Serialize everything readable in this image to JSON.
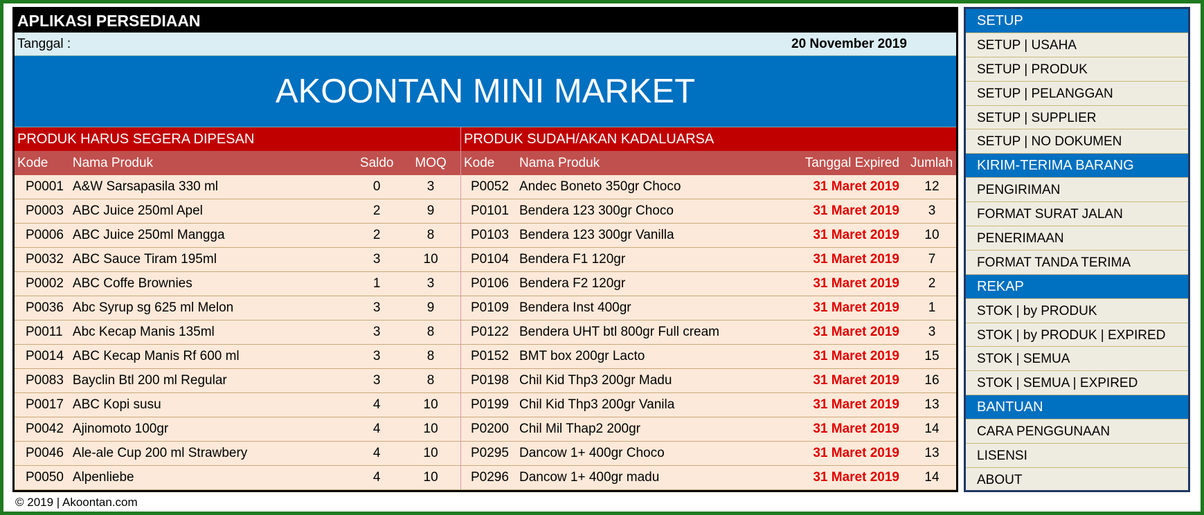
{
  "app": {
    "title": "APLIKASI PERSEDIAAN",
    "date_label": "Tanggal :",
    "date_value": "20 November 2019",
    "banner": "AKOONTAN MINI MARKET",
    "footer": "© 2019 | Akoontan.com"
  },
  "reorder": {
    "title": "PRODUK HARUS SEGERA DIPESAN",
    "headers": {
      "kode": "Kode",
      "nama": "Nama Produk",
      "saldo": "Saldo",
      "moq": "MOQ"
    },
    "rows": [
      {
        "kode": "P0001",
        "nama": "A&W Sarsapasila 330 ml",
        "saldo": "0",
        "moq": "3"
      },
      {
        "kode": "P0003",
        "nama": "ABC Juice 250ml Apel",
        "saldo": "2",
        "moq": "9"
      },
      {
        "kode": "P0006",
        "nama": "ABC Juice 250ml Mangga",
        "saldo": "2",
        "moq": "8"
      },
      {
        "kode": "P0032",
        "nama": "ABC Sauce Tiram 195ml",
        "saldo": "3",
        "moq": "10"
      },
      {
        "kode": "P0002",
        "nama": "ABC Coffe Brownies",
        "saldo": "1",
        "moq": "3"
      },
      {
        "kode": "P0036",
        "nama": "Abc Syrup sg 625 ml Melon",
        "saldo": "3",
        "moq": "9"
      },
      {
        "kode": "P0011",
        "nama": "Abc Kecap Manis 135ml",
        "saldo": "3",
        "moq": "8"
      },
      {
        "kode": "P0014",
        "nama": "ABC Kecap Manis Rf 600 ml",
        "saldo": "3",
        "moq": "8"
      },
      {
        "kode": "P0083",
        "nama": "Bayclin Btl 200 ml Regular",
        "saldo": "3",
        "moq": "8"
      },
      {
        "kode": "P0017",
        "nama": "ABC Kopi susu",
        "saldo": "4",
        "moq": "10"
      },
      {
        "kode": "P0042",
        "nama": "Ajinomoto 100gr",
        "saldo": "4",
        "moq": "10"
      },
      {
        "kode": "P0046",
        "nama": "Ale-ale Cup 200 ml Strawbery",
        "saldo": "4",
        "moq": "10"
      },
      {
        "kode": "P0050",
        "nama": "Alpenliebe",
        "saldo": "4",
        "moq": "10"
      }
    ]
  },
  "expired": {
    "title": "PRODUK SUDAH/AKAN KADALUARSA",
    "headers": {
      "kode": "Kode",
      "nama": "Nama Produk",
      "tanggal": "Tanggal Expired",
      "jumlah": "Jumlah"
    },
    "rows": [
      {
        "kode": "P0052",
        "nama": "Andec Boneto 350gr Choco",
        "tanggal": "31 Maret 2019",
        "jumlah": "12"
      },
      {
        "kode": "P0101",
        "nama": "Bendera 123 300gr Choco",
        "tanggal": "31 Maret 2019",
        "jumlah": "3"
      },
      {
        "kode": "P0103",
        "nama": "Bendera 123 300gr Vanilla",
        "tanggal": "31 Maret 2019",
        "jumlah": "10"
      },
      {
        "kode": "P0104",
        "nama": "Bendera F1 120gr",
        "tanggal": "31 Maret 2019",
        "jumlah": "7"
      },
      {
        "kode": "P0106",
        "nama": "Bendera F2 120gr",
        "tanggal": "31 Maret 2019",
        "jumlah": "2"
      },
      {
        "kode": "P0109",
        "nama": "Bendera Inst 400gr",
        "tanggal": "31 Maret 2019",
        "jumlah": "1"
      },
      {
        "kode": "P0122",
        "nama": "Bendera UHT btl 800gr Full cream",
        "tanggal": "31 Maret 2019",
        "jumlah": "3"
      },
      {
        "kode": "P0152",
        "nama": "BMT box 200gr Lacto",
        "tanggal": "31 Maret 2019",
        "jumlah": "15"
      },
      {
        "kode": "P0198",
        "nama": "Chil Kid Thp3 200gr Madu",
        "tanggal": "31 Maret 2019",
        "jumlah": "16"
      },
      {
        "kode": "P0199",
        "nama": "Chil Kid Thp3 200gr Vanila",
        "tanggal": "31 Maret 2019",
        "jumlah": "13"
      },
      {
        "kode": "P0200",
        "nama": "Chil Mil Thap2 200gr",
        "tanggal": "31 Maret 2019",
        "jumlah": "14"
      },
      {
        "kode": "P0295",
        "nama": "Dancow 1+ 400gr Choco",
        "tanggal": "31 Maret 2019",
        "jumlah": "13"
      },
      {
        "kode": "P0296",
        "nama": "Dancow 1+ 400gr madu",
        "tanggal": "31 Maret 2019",
        "jumlah": "14"
      }
    ]
  },
  "sidebar": {
    "setup": {
      "title": "SETUP",
      "items": [
        "SETUP | USAHA",
        "SETUP | PRODUK",
        "SETUP | PELANGGAN",
        "SETUP | SUPPLIER",
        "SETUP | NO DOKUMEN"
      ]
    },
    "kirim": {
      "title": "KIRIM-TERIMA BARANG",
      "items": [
        "PENGIRIMAN",
        "FORMAT SURAT JALAN",
        "PENERIMAAN",
        "FORMAT TANDA TERIMA"
      ]
    },
    "rekap": {
      "title": "REKAP",
      "items": [
        "STOK | by PRODUK",
        "STOK | by PRODUK | EXPIRED",
        "STOK | SEMUA",
        "STOK | SEMUA | EXPIRED"
      ]
    },
    "bantuan": {
      "title": "BANTUAN",
      "items": [
        "CARA PENGGUNAAN",
        "LISENSI",
        "ABOUT"
      ]
    }
  },
  "colors": {
    "frame": "#1f7a1f",
    "banner": "#0070c0",
    "panel_title": "#c00000",
    "column_header": "#c0504d",
    "row_bg": "#fde9d9",
    "expired_text": "#e00000",
    "menu_bg": "#eeece1"
  }
}
